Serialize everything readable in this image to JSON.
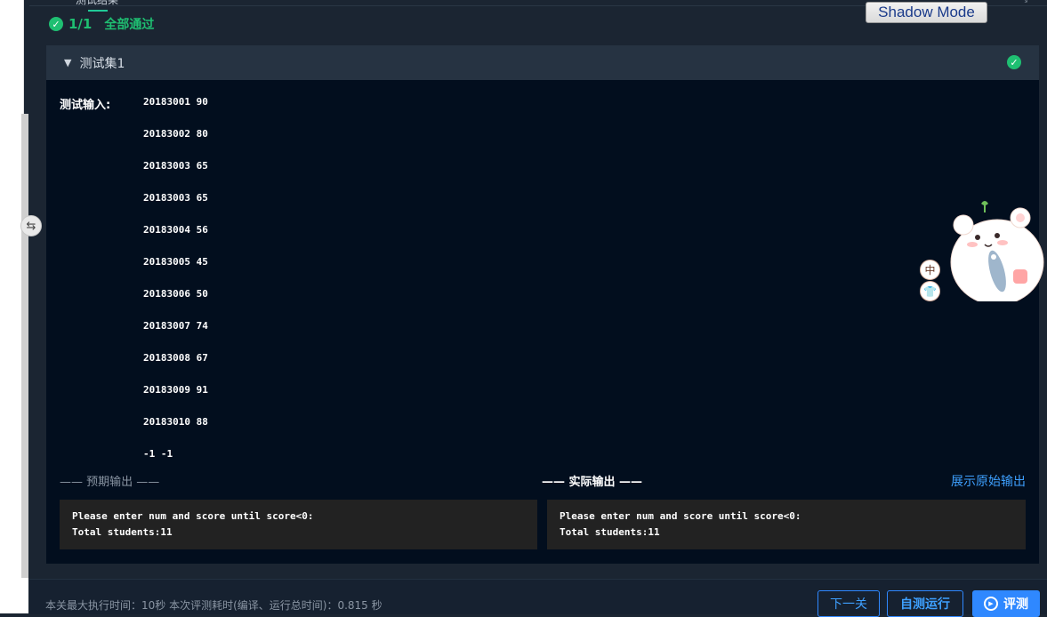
{
  "tab": {
    "label": "测试结果"
  },
  "status": {
    "count": "1/1",
    "passed_label": "全部通过"
  },
  "shadow_mode": {
    "label": "Shadow Mode"
  },
  "test_set": {
    "title": "测试集1"
  },
  "test_input": {
    "label": "测试输入:",
    "lines": [
      "20183001 90",
      "20183002 80",
      "20183003 65",
      "20183003 65",
      "20183004 56",
      "20183005 45",
      "20183006 50",
      "20183007 74",
      "20183008 67",
      "20183009 91",
      "20183010 88",
      "-1 -1"
    ]
  },
  "expected_output": {
    "title": "—— 预期输出 ——",
    "lines": [
      "Please enter num and score until score<0:",
      "Total students:11"
    ]
  },
  "actual_output": {
    "title": "—— 实际输出 ——",
    "lines": [
      "Please enter num and score until score<0:",
      "Total students:11"
    ]
  },
  "raw_output_link": "展示原始输出",
  "footer": {
    "info": "本关最大执行时间：10秒    本次评测耗时(编译、运行总时间)：0.815 秒",
    "next_button": "下一关",
    "self_run_button": "自测运行",
    "evaluate_button": "评测"
  },
  "side_widget": {
    "lang_label": "中"
  },
  "colors": {
    "success": "#1fbf72",
    "accent": "#2f88ff",
    "panel_bg": "#020e1e",
    "output_box_bg": "#222222"
  },
  "icons": [
    "check-circle-icon",
    "caret-down-icon",
    "collapse-toggle-icon",
    "play-circle-icon",
    "mascot-icon"
  ]
}
